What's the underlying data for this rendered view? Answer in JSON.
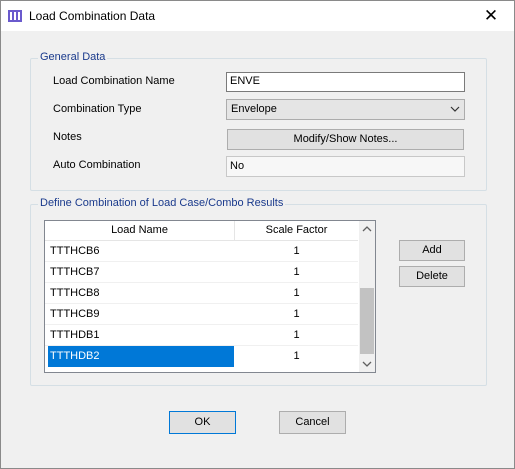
{
  "window": {
    "title": "Load Combination Data",
    "close_glyph": "✕"
  },
  "general": {
    "legend": "General Data",
    "name_label": "Load Combination Name",
    "name_value": "ENVE",
    "type_label": "Combination Type",
    "type_value": "Envelope",
    "notes_label": "Notes",
    "notes_button": "Modify/Show Notes...",
    "auto_label": "Auto Combination",
    "auto_value": "No"
  },
  "define": {
    "legend": "Define Combination of Load Case/Combo Results",
    "col_load_name": "Load Name",
    "col_scale_factor": "Scale Factor",
    "rows": [
      {
        "name": "TTTHCB6",
        "factor": "1"
      },
      {
        "name": "TTTHCB7",
        "factor": "1"
      },
      {
        "name": "TTTHCB8",
        "factor": "1"
      },
      {
        "name": "TTTHCB9",
        "factor": "1"
      },
      {
        "name": "TTTHDB1",
        "factor": "1"
      },
      {
        "name": "TTTHDB2",
        "factor": "1",
        "selected": true
      }
    ],
    "add_button": "Add",
    "delete_button": "Delete"
  },
  "footer": {
    "ok_button": "OK",
    "cancel_button": "Cancel"
  },
  "colors": {
    "selection": "#0078d7",
    "legend_text": "#1a3a8c"
  },
  "icons": {
    "app": "app-grid-icon",
    "close": "close-icon",
    "dropdown": "chevron-down-icon"
  }
}
